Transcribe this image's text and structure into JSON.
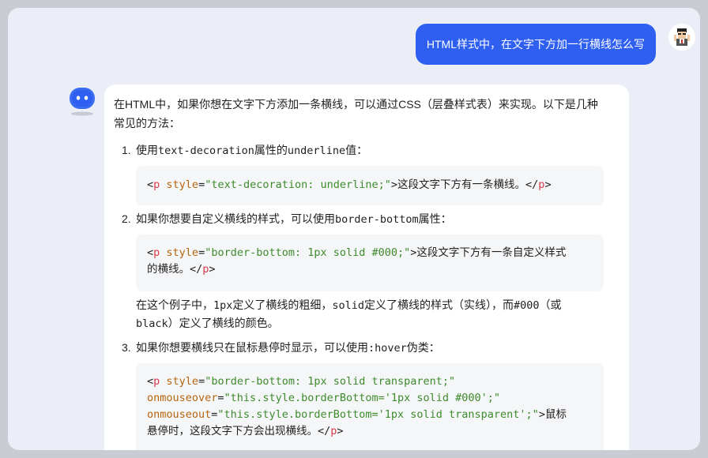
{
  "user": {
    "message": "HTML样式中，在文字下方加一行横线怎么写",
    "avatar_icon": "user-avatar-icon"
  },
  "bot": {
    "avatar_icon": "bot-avatar-icon",
    "intro_line1": "在HTML中，如果你想在文字下方添加一条横线，可以通过CSS（层叠样式表）来实现。以下是几种",
    "intro_line2": "常见的方法：",
    "items": [
      {
        "num": "1.",
        "pre": "使用",
        "mono1": "text-decoration",
        "mid": "属性的",
        "mono2": "underline",
        "post": "值："
      },
      {
        "num": "2.",
        "pre": "如果你想要自定义横线的样式，可以使用",
        "mono1": "border-bottom",
        "post": "属性："
      },
      {
        "num": "3.",
        "pre": "如果你想要横线只在鼠标悬停时显示，可以使用",
        "mono1": ":hover",
        "post": "伪类："
      }
    ],
    "code1": {
      "t1": "<",
      "tag": "p",
      "sp": " ",
      "attr": "style",
      "eq": "=",
      "val": "\"text-decoration: underline;\"",
      "rest": ">这段文字下方有一条横线。</",
      "tag2": "p",
      "end": ">"
    },
    "code2": {
      "t1": "<",
      "tag": "p",
      "sp": " ",
      "attr": "style",
      "eq": "=",
      "val": "\"border-bottom: 1px solid #000;\"",
      "rest": ">这段文字下方有一条自定义样式",
      "line2": "的横线。</",
      "tag2": "p",
      "end": ">"
    },
    "note": {
      "mono1": "1px",
      "a": "定义了横线的粗细，",
      "mono2": "solid",
      "b": "定义了横线的样式（实线），而",
      "mono3": "#000",
      "c": "（或",
      "mono4": "black",
      "d": "）定义了横线的颜色。",
      "prefix": "在这个例子中，"
    },
    "code3": {
      "t1": "<",
      "tag": "p",
      "sp": " ",
      "attr": "style",
      "eq": "=",
      "val": "\"border-bottom: 1px solid transparent;\"",
      "attr2": "onmouseover",
      "eq2": "=",
      "val2": "\"this.style.borderBottom='1px solid #000';\"",
      "attr3": "onmouseout",
      "eq3": "=",
      "val3": "\"this.style.borderBottom='1px solid transparent';\"",
      "rest": ">鼠标",
      "line4": "悬停时，这段文字下方会出现横线。</",
      "tag2": "p",
      "end": ">"
    }
  }
}
